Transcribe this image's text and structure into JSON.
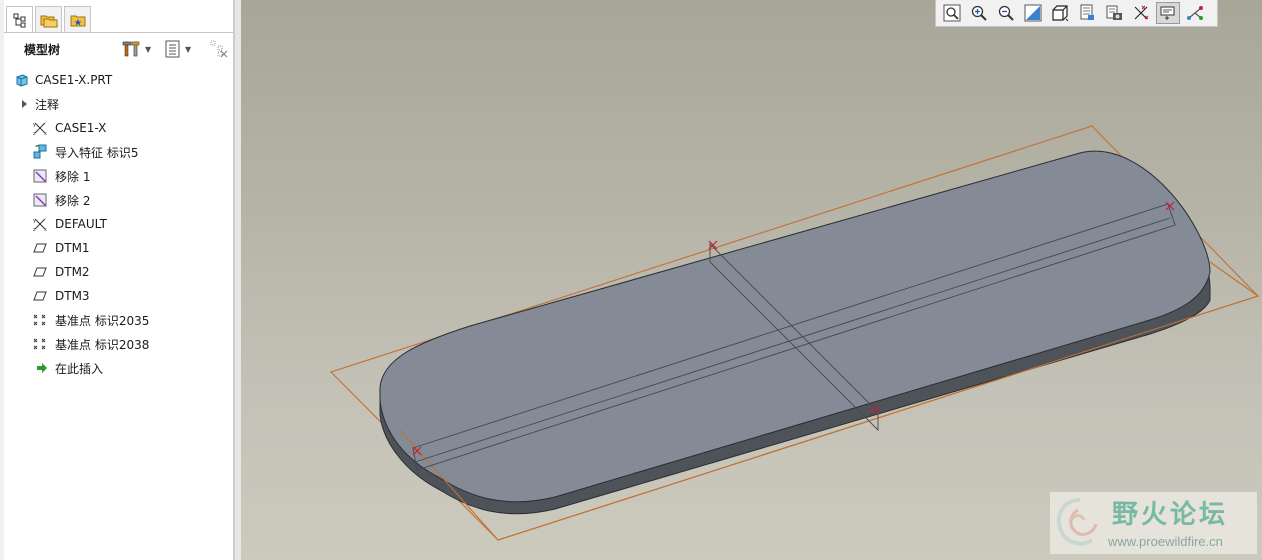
{
  "model_tree": {
    "title": "模型树",
    "tabs": [
      {
        "name": "model-tree-tab",
        "icon": "model-tree-icon"
      },
      {
        "name": "folder-browser-tab",
        "icon": "folder-icon"
      },
      {
        "name": "favorites-tab",
        "icon": "favorites-icon"
      }
    ],
    "items": [
      {
        "label": "CASE1-X.PRT",
        "icon": "part-icon"
      },
      {
        "label": "注释",
        "icon": "expand-arrow-icon"
      },
      {
        "label": "CASE1-X",
        "icon": "coordinate-system-icon"
      },
      {
        "label": "导入特征 标识5",
        "icon": "import-feature-icon"
      },
      {
        "label": "移除 1",
        "icon": "remove-surface-icon"
      },
      {
        "label": "移除 2",
        "icon": "remove-surface-icon"
      },
      {
        "label": "DEFAULT",
        "icon": "coordinate-system-icon"
      },
      {
        "label": "DTM1",
        "icon": "datum-plane-icon"
      },
      {
        "label": "DTM2",
        "icon": "datum-plane-icon"
      },
      {
        "label": "DTM3",
        "icon": "datum-plane-icon"
      },
      {
        "label": "基准点 标识2035",
        "icon": "datum-point-icon"
      },
      {
        "label": "基准点 标识2038",
        "icon": "datum-point-icon"
      },
      {
        "label": "在此插入",
        "icon": "insert-here-arrow-icon"
      }
    ]
  },
  "view_toolbar": [
    {
      "name": "refit-button",
      "icon": "refit-icon"
    },
    {
      "name": "zoom-in-button",
      "icon": "zoom-in-icon"
    },
    {
      "name": "zoom-out-button",
      "icon": "zoom-out-icon"
    },
    {
      "name": "repaint-button",
      "icon": "repaint-icon"
    },
    {
      "name": "display-style-button",
      "icon": "display-style-icon"
    },
    {
      "name": "saved-views-button",
      "icon": "saved-views-icon"
    },
    {
      "name": "view-manager-button",
      "icon": "view-manager-icon"
    },
    {
      "name": "datum-display-button",
      "icon": "datum-display-icon"
    },
    {
      "name": "annotation-display-button",
      "icon": "annotation-display-icon",
      "active": true
    },
    {
      "name": "spin-center-button",
      "icon": "spin-center-icon"
    }
  ],
  "watermark": {
    "title": "野火论坛",
    "url": "www.proewildfire.cn"
  },
  "colors": {
    "part_top": "#848b96",
    "part_side": "#4e535a",
    "datum_plane": "#c07035",
    "datum_point": "#c02040"
  }
}
